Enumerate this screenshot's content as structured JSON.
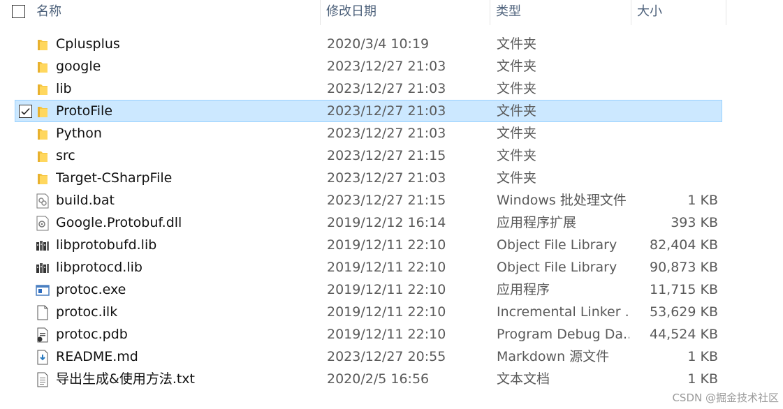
{
  "columns": {
    "name": "名称",
    "date": "修改日期",
    "type": "类型",
    "size": "大小"
  },
  "sort_indicator": "^",
  "selected_row": 3,
  "files": [
    {
      "name": "Cplusplus",
      "date": "2020/3/4 10:19",
      "type": "文件夹",
      "size": "",
      "icon": "folder-icon"
    },
    {
      "name": "google",
      "date": "2023/12/27 21:03",
      "type": "文件夹",
      "size": "",
      "icon": "folder-icon"
    },
    {
      "name": "lib",
      "date": "2023/12/27 21:03",
      "type": "文件夹",
      "size": "",
      "icon": "folder-icon"
    },
    {
      "name": "ProtoFile",
      "date": "2023/12/27 21:03",
      "type": "文件夹",
      "size": "",
      "icon": "folder-icon"
    },
    {
      "name": "Python",
      "date": "2023/12/27 21:03",
      "type": "文件夹",
      "size": "",
      "icon": "folder-icon"
    },
    {
      "name": "src",
      "date": "2023/12/27 21:15",
      "type": "文件夹",
      "size": "",
      "icon": "folder-icon"
    },
    {
      "name": "Target-CSharpFile",
      "date": "2023/12/27 21:03",
      "type": "文件夹",
      "size": "",
      "icon": "folder-icon"
    },
    {
      "name": "build.bat",
      "date": "2023/12/27 21:15",
      "type": "Windows 批处理文件",
      "size": "1 KB",
      "icon": "batch-file-icon"
    },
    {
      "name": "Google.Protobuf.dll",
      "date": "2019/12/12 16:14",
      "type": "应用程序扩展",
      "size": "393 KB",
      "icon": "dll-file-icon"
    },
    {
      "name": "libprotobufd.lib",
      "date": "2019/12/11 22:10",
      "type": "Object File Library",
      "size": "82,404 KB",
      "icon": "library-file-icon"
    },
    {
      "name": "libprotocd.lib",
      "date": "2019/12/11 22:10",
      "type": "Object File Library",
      "size": "90,873 KB",
      "icon": "library-file-icon"
    },
    {
      "name": "protoc.exe",
      "date": "2019/12/11 22:10",
      "type": "应用程序",
      "size": "11,715 KB",
      "icon": "exe-file-icon"
    },
    {
      "name": "protoc.ilk",
      "date": "2019/12/11 22:10",
      "type": "Incremental Linker ...",
      "size": "53,629 KB",
      "icon": "blank-file-icon"
    },
    {
      "name": "protoc.pdb",
      "date": "2019/12/11 22:10",
      "type": "Program Debug Da...",
      "size": "44,524 KB",
      "icon": "pdb-file-icon"
    },
    {
      "name": "README.md",
      "date": "2023/12/27 20:55",
      "type": "Markdown 源文件",
      "size": "1 KB",
      "icon": "markdown-file-icon"
    },
    {
      "name": "导出生成&使用方法.txt",
      "date": "2020/2/5 16:56",
      "type": "文本文档",
      "size": "1 KB",
      "icon": "text-file-icon"
    }
  ],
  "watermark": "CSDN @掘金技术社区"
}
